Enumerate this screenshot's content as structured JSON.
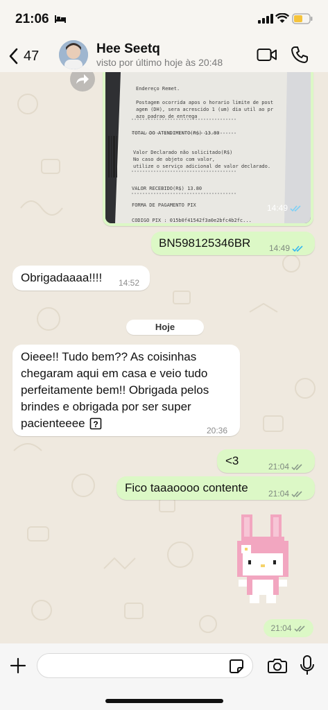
{
  "status_bar": {
    "time": "21:06"
  },
  "header": {
    "back_count": "47",
    "contact_name": "Hee Seetq",
    "contact_status": "visto por último hoje às 20:48"
  },
  "photo_message": {
    "time": "14:49",
    "receipt_lines": [
      "Endereço Remet.",
      "Postagem ocorrida apos o horario limite de post",
      "agem (DH), sera acrescido 1 (um) dia util ao pr",
      "azo padrao de entrega",
      "TOTAL DO ATENDIMENTO(R$)                13.80",
      "Valor Declarado não solicitado(R$)",
      "No caso de objeto com valor,",
      "utilize o serviço adicional de valor declarado.",
      "VALOR RECEBIDO(R$)                      13.80",
      "FORMA DE PAGAMENTO PIX",
      "CODIGO PIX : 015b0f41542f3a0e2bfc4b2fc..."
    ]
  },
  "messages": [
    {
      "text": "BN598125346BR",
      "time": "14:49",
      "dir": "out"
    },
    {
      "text": "Obrigadaaaa!!!!",
      "time": "14:52",
      "dir": "in"
    },
    {
      "text": "Oieee!! Tudo bem?? As coisinhas chegaram aqui em casa e veio tudo perfeitamente bem!! Obrigada pelos brindes e obrigada por ser super pacienteeee",
      "time": "20:36",
      "dir": "in"
    },
    {
      "text": "<3",
      "time": "21:04",
      "dir": "out"
    },
    {
      "text": "Fico taaaoooo contente",
      "time": "21:04",
      "dir": "out"
    }
  ],
  "message_4_lines": [
    "Oieee!! Tudo bem?? As coisinhas",
    "chegaram aqui em casa e veio tudo",
    "perfeitamente bem!! Obrigada pelos",
    "brindes e obrigada por ser super",
    "pacienteeee"
  ],
  "date_divider": "Hoje",
  "sticker_message": {
    "time": "21:04",
    "sticker": "my-melody-pixel-sticker"
  },
  "composer": {
    "placeholder": ""
  },
  "colors": {
    "outgoing": "#dcf8c6",
    "incoming": "#ffffff",
    "read_tick": "#34b7f1",
    "background": "#efe9df"
  }
}
